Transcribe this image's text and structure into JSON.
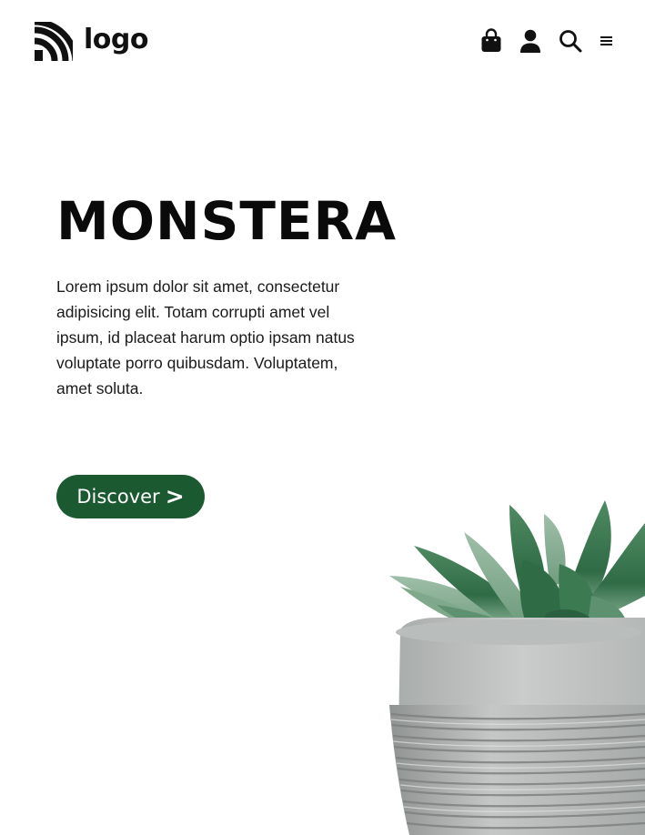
{
  "header": {
    "logo_text": "logo",
    "icons": [
      "shopping-bag-icon",
      "user-icon",
      "search-icon",
      "menu-icon"
    ]
  },
  "hero": {
    "title": "MONSTERA",
    "description": "Lorem ipsum dolor sit amet, consectetur adipisicing elit. Totam corrupti amet vel ipsum, id placeat harum optio ipsam natus voluptate porro quibusdam. Voluptatem, amet soluta.",
    "button_label": "Discover",
    "button_chevron": ">"
  },
  "colors": {
    "accent": "#1b5930",
    "text": "#0a0a0a",
    "background": "#ffffff"
  }
}
